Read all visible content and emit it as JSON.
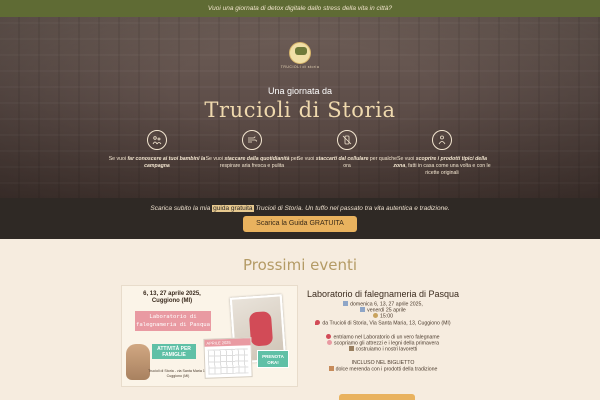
{
  "topbar": {
    "text": "Vuoi una giornata di detox digitale dallo stress della vita in città?"
  },
  "hero": {
    "logo_text": "TRUCIOLI di storia",
    "subtitle": "Una giornata da",
    "title": "Trucioli di Storia",
    "features": [
      {
        "icon": "family-icon",
        "text_a": "Se vuoi ",
        "text_em": "far conoscere ai tuoi bambini la campagna",
        "text_b": ""
      },
      {
        "icon": "fresh-air-icon",
        "text_a": "Se vuoi ",
        "text_em": "staccare dalla quotidianità",
        "text_b": " per respirare aria fresca e pulita"
      },
      {
        "icon": "phone-off-icon",
        "text_a": "Se vuoi ",
        "text_em": "staccarti dal cellulare",
        "text_b": " per qualche ora"
      },
      {
        "icon": "farm-products-icon",
        "text_a": "Se vuoi ",
        "text_em": "scoprire i prodotti tipici della zona",
        "text_b": ", fatti in casa come una volta e con le ricette originali"
      }
    ]
  },
  "download": {
    "text_before": "Scarica subito la mia ",
    "highlight": "guida gratuita",
    "text_after": " Trucioli di Storia. Un tuffo nel passato tra vita autentica e tradizione.",
    "button": "Scarica la Guida GRATUITA"
  },
  "events": {
    "section_title": "Prossimi eventi",
    "image": {
      "date": "6, 13, 27 aprile 2025,",
      "place": "Cuggiono (MI)",
      "banner": "Laboratorio di falegnameria di Pasqua",
      "calendar_month": "APRILE 2025",
      "tag": "ATTIVITÀ PER FAMIGLIE",
      "address": "Trucioli di Storia - via Santa Maria 13, Cuggiono (MI)",
      "badge": "PRENOTA ORA!"
    },
    "title": "Laboratorio di falegnameria di Pasqua",
    "dates": "domenica 6, 13, 27 aprile 2025,",
    "dates2": "venerdì 25 aprile",
    "time": "15:00",
    "location": "da Trucioli di Storia, Via Santa Maria, 13, Cuggiono (MI)",
    "item1": "entriamo nel Laboratorio di un vero falegname",
    "item2": "scopriamo gli attrezzi e i legni della primavera",
    "item3": "costruiamo i nostri lavoretti",
    "included_label": "INCLUSO NEL BIGLIETTO",
    "included_item": "dolce merenda con i prodotti della tradizione"
  },
  "colors": {
    "topbar": "#5f6b34",
    "accent": "#e9b25e",
    "section_title": "#b49b66",
    "pink": "#e99aa2",
    "green": "#5fc0a6"
  }
}
